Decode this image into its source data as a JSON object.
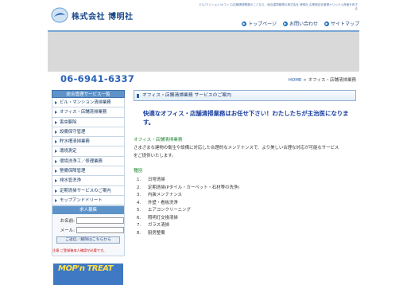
{
  "header": {
    "company_name": "株式会社 博明社",
    "tagline": "ビル/マンション/オフィス/店舗清掃業務のことなら、総合建物管理の株式会社 博明社 企業様自社管理オリジナル資格を有する",
    "nav": [
      {
        "label": "トップページ"
      },
      {
        "label": "お問い合わせ"
      },
      {
        "label": "サイトマップ"
      }
    ]
  },
  "phone": "06-6941-6337",
  "breadcrumb": {
    "home": "HOME",
    "separator": " > ",
    "current": "オフィス・店舗清掃業務"
  },
  "sidebar": {
    "title": "総合管理サービス一覧",
    "items": [
      {
        "label": "ビル・マンション清掃業務"
      },
      {
        "label": "オフィス・店舗清掃業務"
      },
      {
        "label": "害虫駆除"
      },
      {
        "label": "設備保守管理"
      },
      {
        "label": "貯水槽清掃業務"
      },
      {
        "label": "環境測定"
      },
      {
        "label": "環境洗浄工／修理業務"
      },
      {
        "label": "警備保障管理"
      },
      {
        "label": "排水管洗浄"
      },
      {
        "label": "定期清掃サービスのご案内"
      },
      {
        "label": "モップアンドドリート"
      }
    ]
  },
  "recruit": {
    "title": "求人募集",
    "name_label": "お名前:",
    "mail_label": "メール:",
    "button_label": "ご返信／解除はこちらから",
    "note": "注意 ご登録後本人確認が必要です。"
  },
  "ad": {
    "text": "MOP'n TREAT"
  },
  "content": {
    "heading": "オフィス・店舗清掃業務 サービスのご案内",
    "lead": "快適なオフィス・店舗清掃業務はお任せ下さい！わたしたちが主治医になります。",
    "section_title": "オフィス・店舗清掃業務",
    "description": "さまざまな建物の衛生や設備に対応した合理的なメンテナンスで、より美しい合理な対応が可能なサービスをご提供いたします。",
    "category_title": "種別",
    "items": [
      {
        "num": "1.",
        "label": "日常清掃"
      },
      {
        "num": "2.",
        "label": "定期清掃(Pタイル・カーペット・石材等の洗浄)"
      },
      {
        "num": "3.",
        "label": "内装メンテナンス"
      },
      {
        "num": "4.",
        "label": "外壁・看板洗浄"
      },
      {
        "num": "5.",
        "label": "エアコンクリーニング"
      },
      {
        "num": "6.",
        "label": "照明灯交換清掃"
      },
      {
        "num": "7.",
        "label": "ガラス清掃"
      },
      {
        "num": "8.",
        "label": "厨房整備"
      }
    ]
  },
  "colors": {
    "accent": "#2a62b8",
    "sidebar_head": "#5e93c9",
    "banner": "#d9d9d9"
  }
}
